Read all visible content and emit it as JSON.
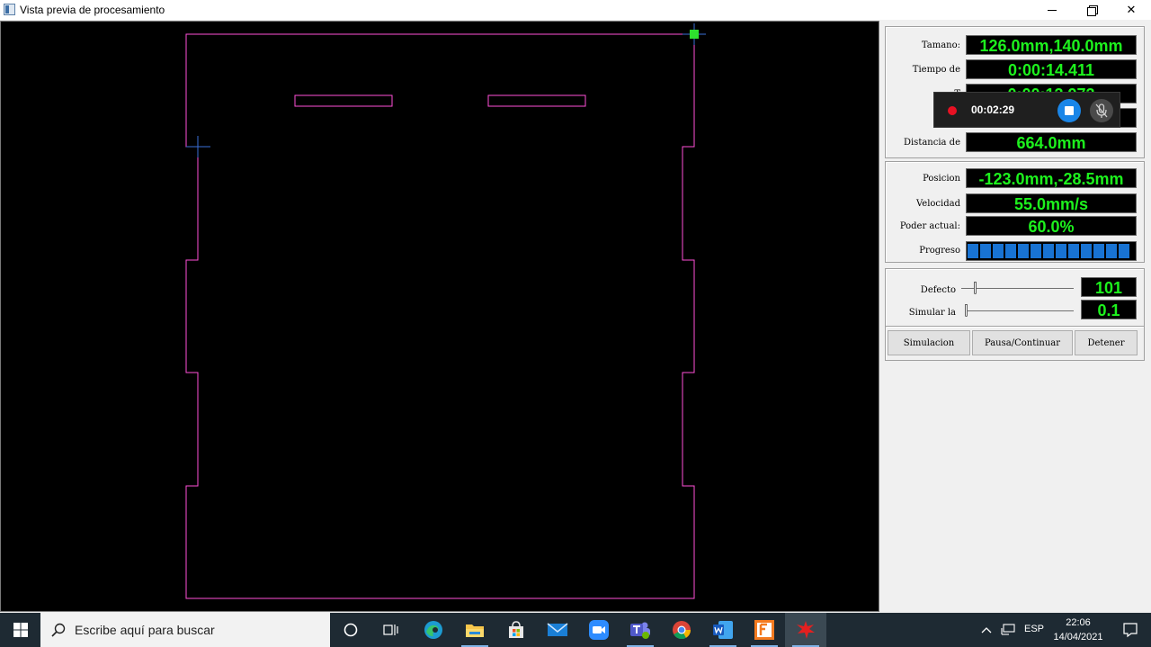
{
  "window": {
    "title": "Vista previa de procesamiento"
  },
  "info": {
    "size_label": "Tamano:",
    "size_value": "126.0mm,140.0mm",
    "time_label": "Tiempo de",
    "time_value": "0:00:14.411",
    "t2_label": "T",
    "t2_value": "0:00:13.973",
    "dist_label": "Dist",
    "dist_value": "",
    "distance_label": "Distancia de",
    "distance_value": "664.0mm"
  },
  "motion": {
    "position_label": "Posicion",
    "position_value": "-123.0mm,-28.5mm",
    "speed_label": "Velocidad",
    "speed_value": "55.0mm/s",
    "power_label": "Poder actual:",
    "power_value": "60.0%",
    "progress_label": "Progreso",
    "progress_fraction": 1.0
  },
  "sliders": {
    "default_label": "Defecto",
    "default_value": "101",
    "simulate_label": "Simular la",
    "simulate_value": "0.1"
  },
  "buttons": {
    "simulate": "Simulacion",
    "pause": "Pausa/Continuar",
    "stop": "Detener"
  },
  "recording": {
    "time": "00:02:29"
  },
  "taskbar": {
    "search_placeholder": "Escribe aquí para buscar",
    "lang": "ESP",
    "time": "22:06",
    "date": "14/04/2021"
  },
  "colors": {
    "path": "#ff4fd8",
    "readout": "#1df21d",
    "progress": "#1873d3"
  }
}
